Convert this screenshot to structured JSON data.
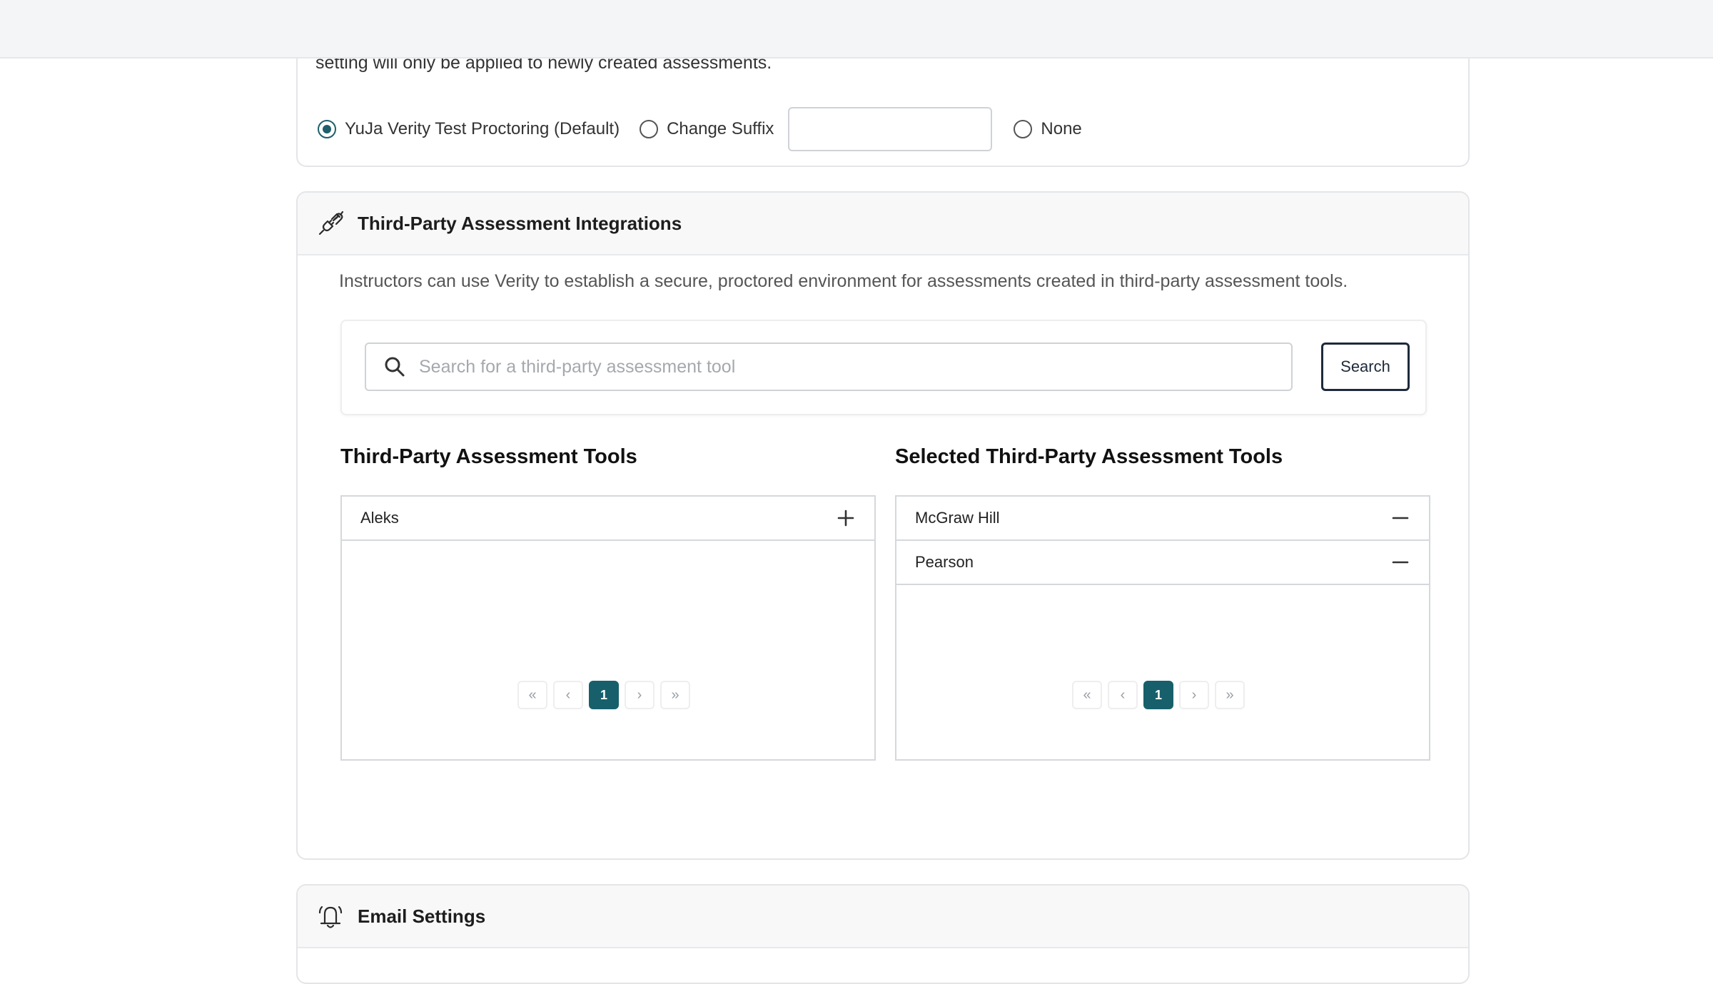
{
  "suffix_section": {
    "notice": "setting will only be applied to newly created assessments.",
    "options": [
      {
        "label": "YuJa Verity Test Proctoring (Default)",
        "checked": true
      },
      {
        "label": "Change Suffix",
        "checked": false
      },
      {
        "label": "None",
        "checked": false
      }
    ],
    "suffix_value": ""
  },
  "third_party": {
    "title": "Third-Party Assessment Integrations",
    "icon": "plug-icon",
    "description": "Instructors can use Verity to establish a secure, proctored environment for assessments created in third-party assessment tools.",
    "search_placeholder": "Search for a third-party assessment tool",
    "search_button": "Search",
    "available": {
      "title": "Third-Party Assessment Tools",
      "items": [
        "Aleks"
      ],
      "page": "1"
    },
    "selected": {
      "title": "Selected Third-Party Assessment Tools",
      "items": [
        "McGraw Hill",
        "Pearson"
      ],
      "page": "1"
    }
  },
  "email": {
    "title": "Email Settings",
    "icon": "bell-icon"
  },
  "colors": {
    "accent": "#17606b",
    "button_border": "#1e2a3a"
  }
}
